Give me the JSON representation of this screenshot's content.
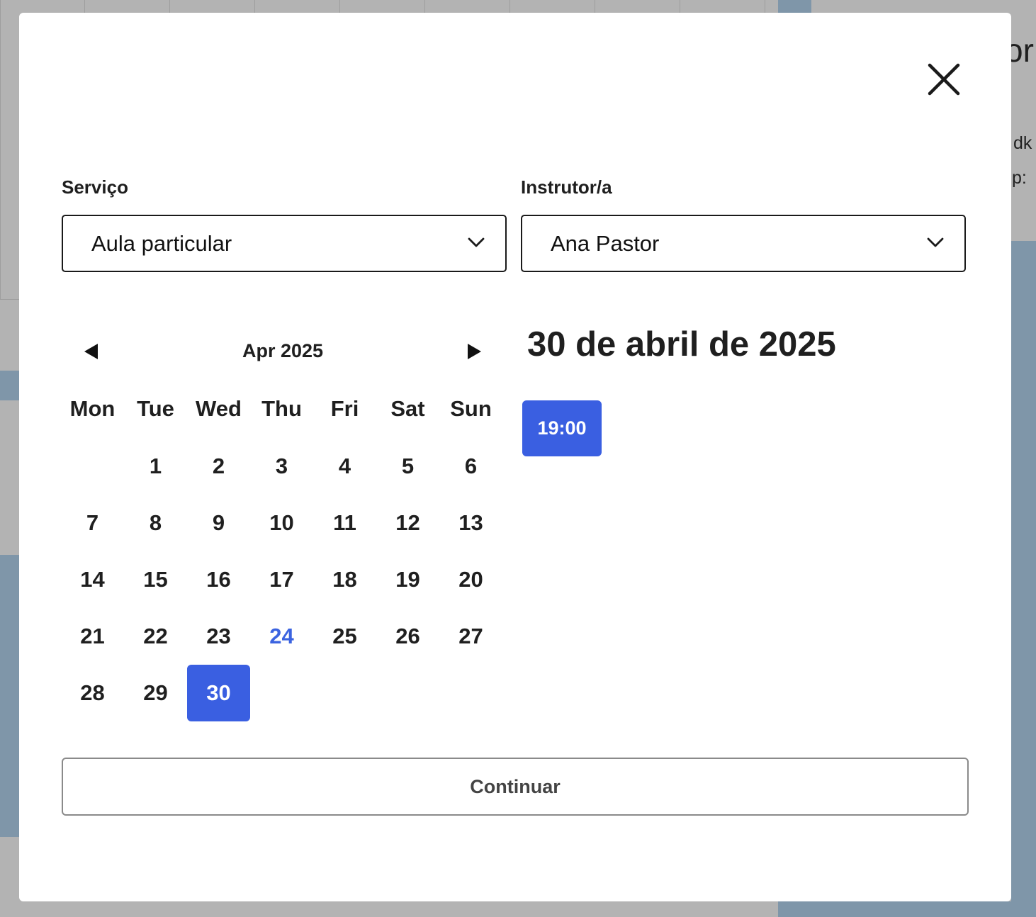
{
  "background": {
    "partial_texts": [
      "or",
      "dk",
      "p:"
    ]
  },
  "modal": {
    "close_icon": "close-icon",
    "service": {
      "label": "Serviço",
      "value": "Aula particular"
    },
    "instructor": {
      "label": "Instrutor/a",
      "value": "Ana Pastor"
    },
    "calendar": {
      "month_label": "Apr 2025",
      "weekdays": [
        "Mon",
        "Tue",
        "Wed",
        "Thu",
        "Fri",
        "Sat",
        "Sun"
      ],
      "first_weekday_offset": 1,
      "days_in_month": 30,
      "today": 24,
      "selected": 30,
      "prev_icon": "triangle-left-icon",
      "next_icon": "triangle-right-icon"
    },
    "selected_date_heading": "30 de abril de 2025",
    "time_slots": [
      "19:00"
    ],
    "continue_label": "Continuar"
  },
  "colors": {
    "accent": "#3a5fe1",
    "today": "#3b63e0",
    "backdrop": "#b3b3b3",
    "backdrop_blue": "#7f96a9"
  }
}
